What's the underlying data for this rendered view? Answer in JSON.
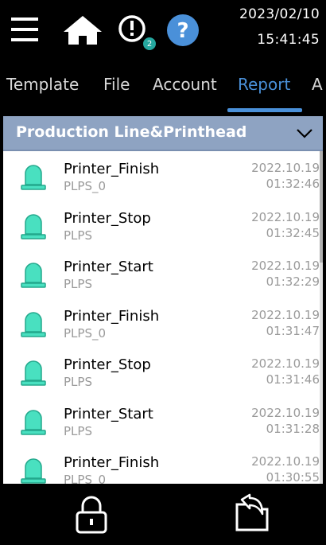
{
  "header": {
    "icons": [
      "menu-icon",
      "home-icon",
      "alarm-icon",
      "help-icon"
    ],
    "alarm_badge": "2",
    "date": "2023/02/10",
    "time": "15:41:45"
  },
  "tabs": [
    {
      "label": "Template"
    },
    {
      "label": "File"
    },
    {
      "label": "Account"
    },
    {
      "label": "Report",
      "active": true
    },
    {
      "label": "Al"
    }
  ],
  "section": {
    "title": "Production Line&Printhead",
    "icon": "chevron-down-icon"
  },
  "records": [
    {
      "event": "Printer_Finish",
      "source": "PLPS_0",
      "date": "2022.10.19",
      "time": "01:32:46"
    },
    {
      "event": "Printer_Stop",
      "source": "PLPS",
      "date": "2022.10.19",
      "time": "01:32:45"
    },
    {
      "event": "Printer_Start",
      "source": "PLPS",
      "date": "2022.10.19",
      "time": "01:32:29"
    },
    {
      "event": "Printer_Finish",
      "source": "PLPS_0",
      "date": "2022.10.19",
      "time": "01:31:47"
    },
    {
      "event": "Printer_Stop",
      "source": "PLPS",
      "date": "2022.10.19",
      "time": "01:31:46"
    },
    {
      "event": "Printer_Start",
      "source": "PLPS",
      "date": "2022.10.19",
      "time": "01:31:28"
    },
    {
      "event": "Printer_Finish",
      "source": "PLPS_0",
      "date": "2022.10.19",
      "time": "01:30:55"
    }
  ],
  "footer": {
    "icons": [
      "lock-icon",
      "back-icon"
    ]
  },
  "colors": {
    "accent": "#4a90d9",
    "badge": "#25a8a0",
    "section_bg": "#8ea3c2",
    "status_light": "#49e0c0"
  }
}
